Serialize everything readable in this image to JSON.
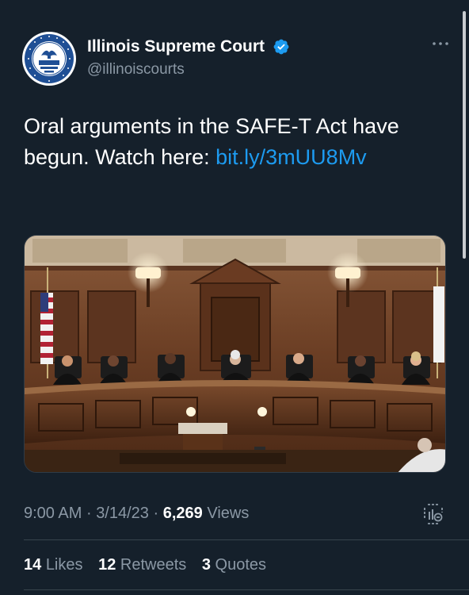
{
  "tweet": {
    "author": {
      "display_name": "Illinois Supreme Court",
      "handle": "@illinoiscourts",
      "verified": true,
      "avatar": {
        "icon": "illinois-state-seal",
        "seal_text_top": "SEAL OF THE SUPREME COURT",
        "seal_text_bottom": "STATE OF ILLINOIS",
        "seal_date": "AUG. 26, 1818"
      }
    },
    "text_plain": "Oral arguments in the SAFE-T Act have begun. Watch here: ",
    "text_link": "bit.ly/3mUU8Mv",
    "media": {
      "type": "image",
      "icon": "courtroom-photo"
    },
    "meta": {
      "time": "9:00 AM",
      "separator": "·",
      "date": "3/14/23",
      "views_count": "6,269",
      "views_label": "Views"
    },
    "stats": {
      "likes_count": "14",
      "likes_label": "Likes",
      "retweets_count": "12",
      "retweets_label": "Retweets",
      "quotes_count": "3",
      "quotes_label": "Quotes"
    }
  },
  "colors": {
    "background": "#15202b",
    "text_primary": "#ffffff",
    "text_secondary": "#8b98a5",
    "link": "#1d9bf0",
    "verified": "#1d9bf0",
    "divider": "#38444d"
  }
}
